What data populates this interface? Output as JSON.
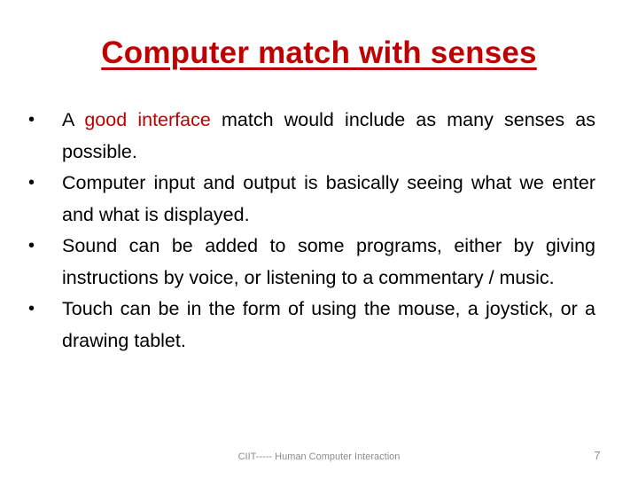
{
  "slide": {
    "title": "Computer match with senses",
    "colors": {
      "title": "#C00000",
      "highlight": "#C00000",
      "body_text": "#000000",
      "footer": "#8c8c8c"
    },
    "bullets": [
      {
        "prefix": "A ",
        "highlight": "good interface",
        "suffix": " match would include as many senses as possible."
      },
      {
        "text": "Computer input and output is basically seeing what we enter and what is displayed."
      },
      {
        "text": "Sound can be added to some programs, either by giving instructions by voice, or listening to a commentary / music."
      },
      {
        "text": "Touch can be in the form of using the mouse, a joystick, or a drawing tablet."
      }
    ],
    "bullet_glyph": "•",
    "footer": "CIIT----- Human Computer Interaction",
    "page_number": "7"
  }
}
